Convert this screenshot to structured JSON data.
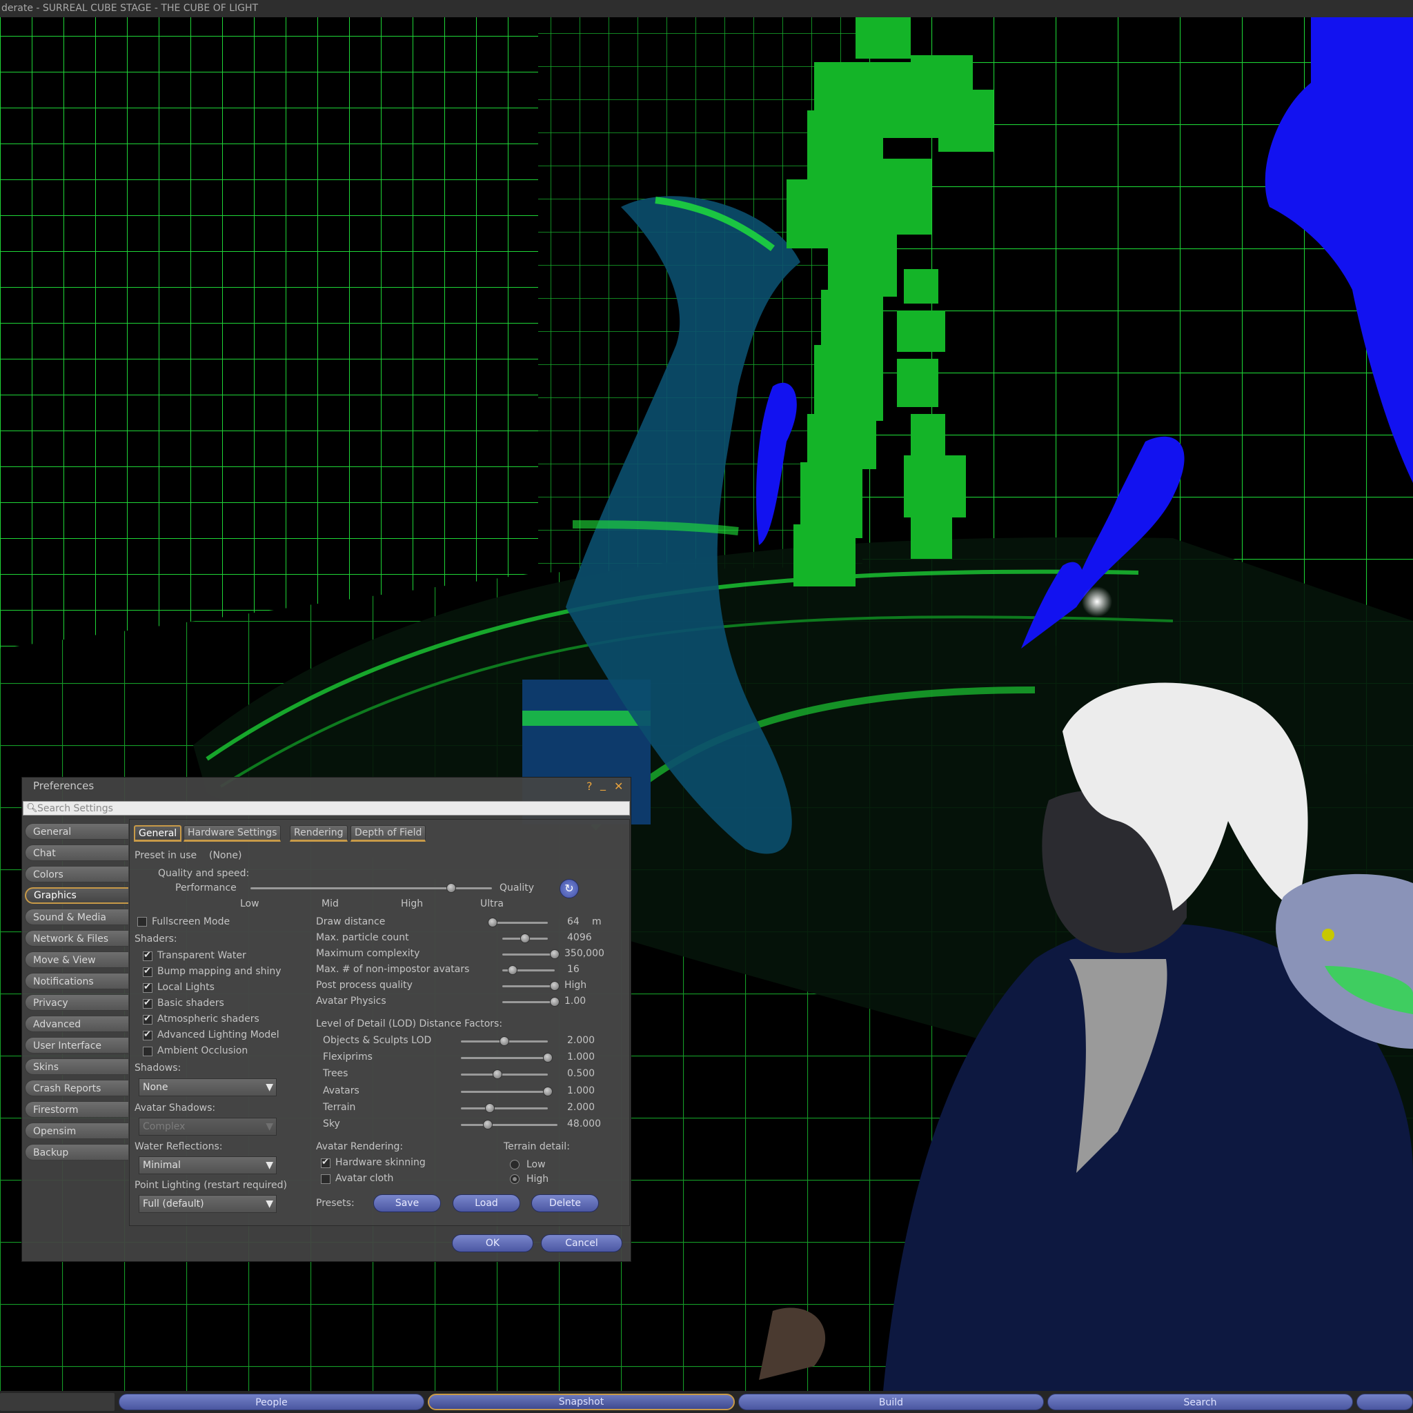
{
  "window": {
    "title": "derate - SURREAL CUBE STAGE - THE CUBE OF LIGHT"
  },
  "toolbar": {
    "buttons": [
      "People",
      "Snapshot",
      "Build",
      "Search"
    ]
  },
  "prefs": {
    "title": "Preferences",
    "help_icon": "?",
    "minimize_icon": "_",
    "close_icon": "✕",
    "search": {
      "placeholder": "Search Settings",
      "value": ""
    },
    "sidebar": [
      "General",
      "Chat",
      "Colors",
      "Graphics",
      "Sound & Media",
      "Network & Files",
      "Move & View",
      "Notifications",
      "Privacy",
      "Advanced",
      "User Interface",
      "Skins",
      "Crash Reports",
      "Firestorm",
      "Opensim",
      "Backup"
    ],
    "sidebar_selected": "Graphics",
    "tabs": [
      "General",
      "Hardware Settings",
      "Rendering",
      "Depth of Field"
    ],
    "tab_selected": "General",
    "preset_label": "Preset in use",
    "preset_value": "(None)",
    "quality_label": "Quality and speed:",
    "performance_label": "Performance",
    "quality_end_label": "Quality",
    "quality_ticks": [
      "Low",
      "Mid",
      "High",
      "Ultra"
    ],
    "quality_level": 0.83,
    "fullscreen": {
      "label": "Fullscreen Mode",
      "checked": false
    },
    "shaders_label": "Shaders:",
    "shaders": [
      {
        "label": "Transparent Water",
        "checked": true
      },
      {
        "label": "Bump mapping and shiny",
        "checked": true
      },
      {
        "label": "Local Lights",
        "checked": true
      },
      {
        "label": "Basic shaders",
        "checked": true
      },
      {
        "label": "Atmospheric shaders",
        "checked": true
      },
      {
        "label": "Advanced Lighting Model",
        "checked": true
      },
      {
        "label": "Ambient Occlusion",
        "checked": false
      }
    ],
    "shadows_label": "Shadows:",
    "shadows_value": "None",
    "avatar_shadows_label": "Avatar Shadows:",
    "avatar_shadows_value": "Complex",
    "water_reflections_label": "Water Reflections:",
    "water_reflections_value": "Minimal",
    "point_lighting_label": "Point Lighting (restart required)",
    "point_lighting_value": "Full (default)",
    "settings": [
      {
        "label": "Draw distance",
        "value": "64",
        "unit": "m",
        "level": 0.0
      },
      {
        "label": "Max. particle count",
        "value": "4096",
        "unit": "",
        "level": 0.5
      },
      {
        "label": "Maximum complexity",
        "value": "350,000",
        "unit": "",
        "level": 1.0
      },
      {
        "label": "Max. # of non-impostor avatars",
        "value": "16",
        "unit": "",
        "level": 0.2
      },
      {
        "label": "Post process quality",
        "value": "High",
        "unit": "",
        "level": 1.0
      },
      {
        "label": "Avatar Physics",
        "value": "1.00",
        "unit": "",
        "level": 1.0
      }
    ],
    "lod_label": "Level of Detail (LOD) Distance Factors:",
    "lod": [
      {
        "label": "Objects & Sculpts LOD",
        "value": "2.000",
        "level": 0.5
      },
      {
        "label": "Flexiprims",
        "value": "1.000",
        "level": 1.0
      },
      {
        "label": "Trees",
        "value": "0.500",
        "level": 0.42
      },
      {
        "label": "Avatars",
        "value": "1.000",
        "level": 1.0
      },
      {
        "label": "Terrain",
        "value": "2.000",
        "level": 0.33
      },
      {
        "label": "Sky",
        "value": "48.000",
        "level": 0.28
      }
    ],
    "avatar_rendering_label": "Avatar Rendering:",
    "avatar_rendering": [
      {
        "label": "Hardware skinning",
        "checked": true
      },
      {
        "label": "Avatar cloth",
        "checked": false
      }
    ],
    "terrain_detail_label": "Terrain detail:",
    "terrain_detail": [
      {
        "label": "Low",
        "selected": false
      },
      {
        "label": "High",
        "selected": true
      }
    ],
    "presets_label": "Presets:",
    "preset_buttons": {
      "save": "Save",
      "load": "Load",
      "delete": "Delete"
    },
    "ok_label": "OK",
    "cancel_label": "Cancel"
  },
  "colors": {
    "accent": "#c89a48",
    "button": "#5a66b4",
    "grid": "#1fe63a",
    "blue_object": "#1212f0"
  }
}
